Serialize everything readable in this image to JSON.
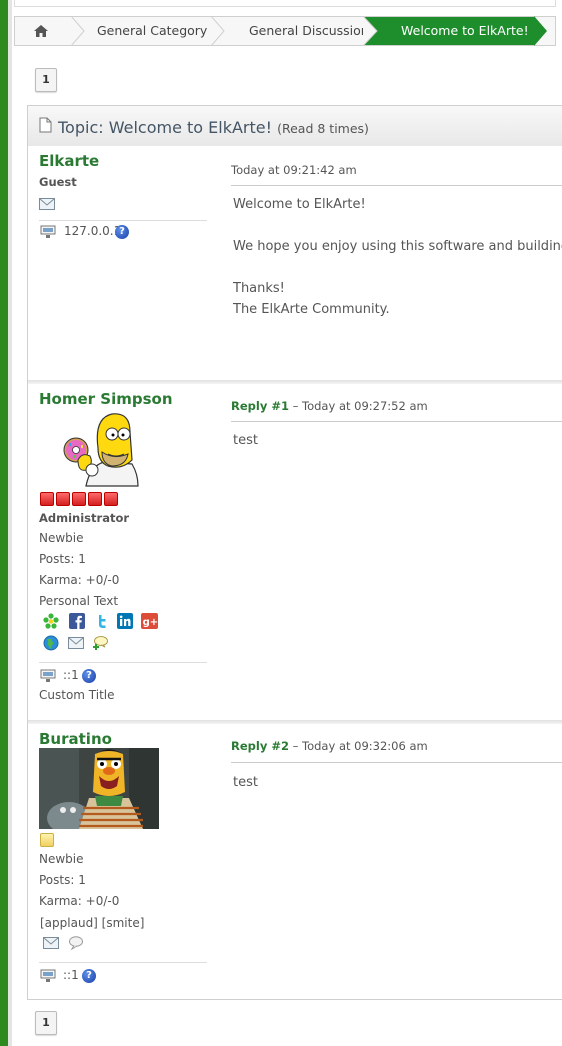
{
  "breadcrumb": {
    "home_icon": "home-icon",
    "items": [
      "General Category",
      "General Discussion",
      "Welcome to ElkArte!"
    ]
  },
  "pager": {
    "top_page": "1",
    "bottom_page": "1"
  },
  "topic": {
    "icon": "document-icon",
    "title": "Topic: Welcome to ElkArte!",
    "reads": "(Read 8 times)"
  },
  "posts": [
    {
      "name": "Elkarte",
      "group": "Guest",
      "ip": "127.0.0.1",
      "time": "Today at 09:21:42 am",
      "body": [
        "Welcome to ElkArte!",
        "",
        "We hope you enjoy using this software and building yo",
        "",
        "Thanks!",
        "The ElkArte Community."
      ]
    },
    {
      "name": "Homer Simpson",
      "group": "Administrator",
      "rank": "Newbie",
      "posts": "Posts: 1",
      "karma": "Karma: +0/-0",
      "personal_text": "Personal Text",
      "ip": "::1",
      "custom_title": "Custom Title",
      "reply_label": "Reply #1",
      "time": " – Today at 09:27:52 am",
      "body": [
        "test"
      ]
    },
    {
      "name": "Buratino",
      "rank": "Newbie",
      "posts": "Posts: 1",
      "karma": "Karma: +0/-0",
      "applaud": "[applaud] [smite]",
      "ip": "::1",
      "reply_label": "Reply #2",
      "time": " – Today at 09:32:06 am",
      "body": [
        "test"
      ]
    }
  ],
  "colors": {
    "accent": "#1e8e2c",
    "name": "#2a7a33"
  }
}
